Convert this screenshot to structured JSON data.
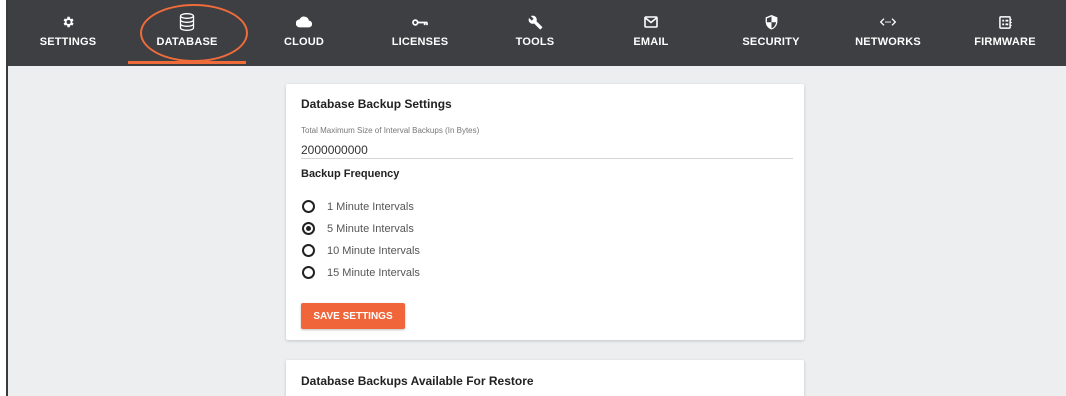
{
  "nav": {
    "items": [
      {
        "label": "SETTINGS",
        "icon": "gear-icon"
      },
      {
        "label": "DATABASE",
        "icon": "database-icon"
      },
      {
        "label": "CLOUD",
        "icon": "cloud-icon"
      },
      {
        "label": "LICENSES",
        "icon": "key-icon"
      },
      {
        "label": "TOOLS",
        "icon": "wrench-icon"
      },
      {
        "label": "EMAIL",
        "icon": "mail-icon"
      },
      {
        "label": "SECURITY",
        "icon": "shield-icon"
      },
      {
        "label": "NETWORKS",
        "icon": "code-arrows-icon"
      },
      {
        "label": "FIRMWARE",
        "icon": "firmware-icon"
      }
    ],
    "active": "DATABASE"
  },
  "backup_settings": {
    "title": "Database Backup Settings",
    "max_size_label": "Total Maximum Size of Interval Backups (In Bytes)",
    "max_size_value": "2000000000",
    "frequency_label": "Backup Frequency",
    "options": [
      {
        "label": "1 Minute Intervals",
        "checked": false
      },
      {
        "label": "5 Minute Intervals",
        "checked": true
      },
      {
        "label": "10 Minute Intervals",
        "checked": false
      },
      {
        "label": "15 Minute Intervals",
        "checked": false
      }
    ],
    "save_label": "SAVE SETTINGS"
  },
  "restore": {
    "title": "Database Backups Available For Restore"
  },
  "colors": {
    "navbar_bg": "#3d3f43",
    "accent": "#f0663a",
    "page_bg": "#eceef0"
  }
}
